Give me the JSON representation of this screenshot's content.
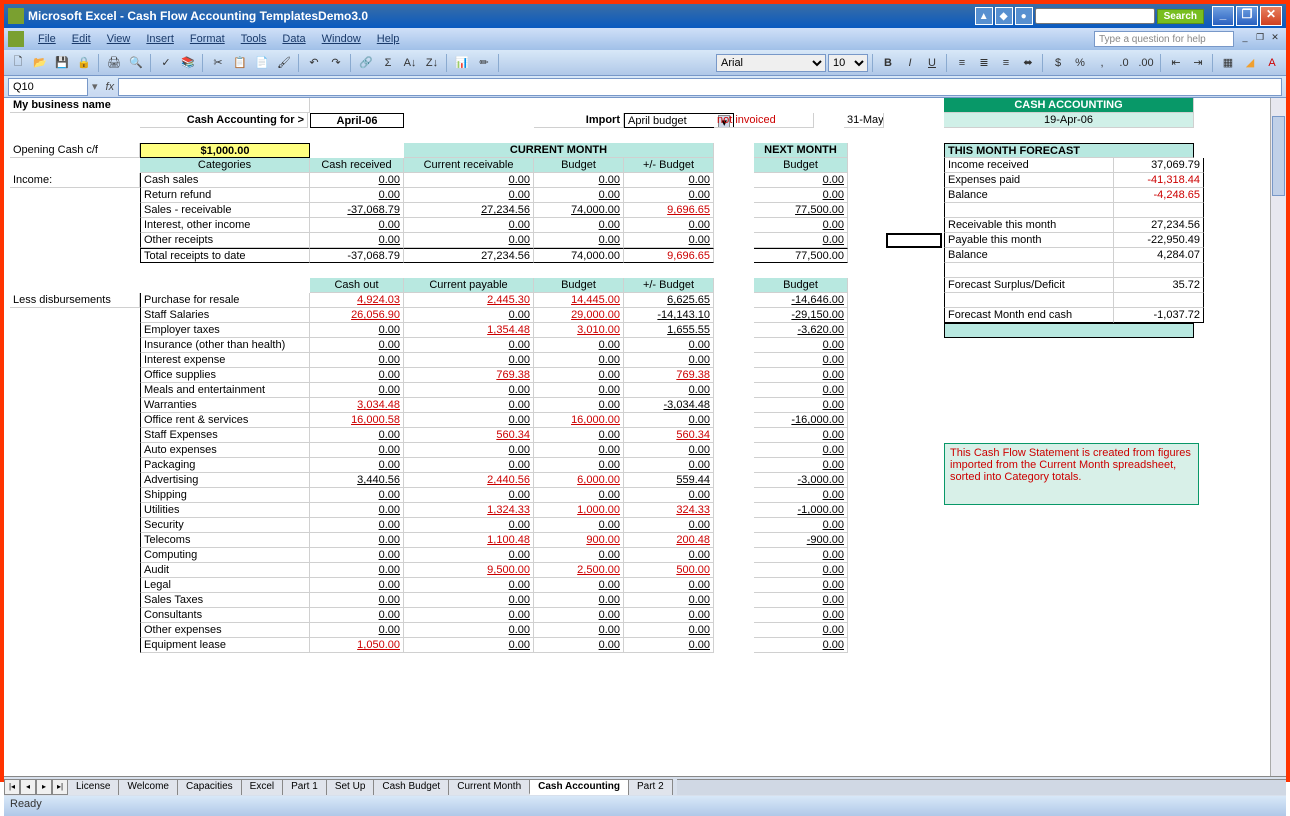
{
  "app": {
    "title": "Microsoft Excel - Cash Flow Accounting TemplatesDemo3.0",
    "search_btn": "Search",
    "help_placeholder": "Type a question for help"
  },
  "menu": [
    "File",
    "Edit",
    "View",
    "Insert",
    "Format",
    "Tools",
    "Data",
    "Window",
    "Help"
  ],
  "namebox": "Q10",
  "font_name": "Arial",
  "font_size": "10",
  "header": {
    "business": "My business name",
    "label": "Cash Accounting for >",
    "period": "April-06",
    "import_label": "Import",
    "import_value": "April budget",
    "import_note": "not invoiced",
    "next_date": "31-May-06",
    "badge": "CASH ACCOUNTING",
    "badge_date": "19-Apr-06"
  },
  "opening": {
    "label": "Opening Cash c/f",
    "value": "$1,000.00",
    "current_month": "CURRENT MONTH",
    "next_month": "NEXT MONTH",
    "forecast_title": "THIS MONTH FORECAST"
  },
  "cols_income": {
    "categories": "Categories",
    "cash_received": "Cash received",
    "current_receivable": "Current receivable",
    "budget": "Budget",
    "pm_budget": "+/- Budget",
    "next_budget": "Budget"
  },
  "income_label": "Income:",
  "income_rows": [
    {
      "cat": "Cash sales",
      "v": [
        "0.00",
        "0.00",
        "0.00",
        "0.00",
        "0.00"
      ]
    },
    {
      "cat": "Return refund",
      "v": [
        "0.00",
        "0.00",
        "0.00",
        "0.00",
        "0.00"
      ]
    },
    {
      "cat": "Sales - receivable",
      "v": [
        "-37,068.79",
        "27,234.56",
        "74,000.00",
        "9,696.65",
        "77,500.00"
      ],
      "neg": [
        3
      ]
    },
    {
      "cat": "Interest, other income",
      "v": [
        "0.00",
        "0.00",
        "0.00",
        "0.00",
        "0.00"
      ]
    },
    {
      "cat": "Other receipts",
      "v": [
        "0.00",
        "0.00",
        "0.00",
        "0.00",
        "0.00"
      ]
    }
  ],
  "income_total": {
    "cat": "Total receipts to date",
    "v": [
      "-37,068.79",
      "27,234.56",
      "74,000.00",
      "9,696.65",
      "77,500.00"
    ],
    "neg": [
      3
    ]
  },
  "cols_exp": {
    "cash_out": "Cash out",
    "current_payable": "Current payable",
    "budget": "Budget",
    "pm_budget": "+/- Budget",
    "next_budget": "Budget"
  },
  "less_label": "Less disbursements",
  "exp_rows": [
    {
      "cat": "Purchase for resale",
      "v": [
        "4,924.03",
        "2,445.30",
        "14,445.00",
        "6,625.65",
        "-14,646.00"
      ],
      "neg": [
        0,
        1,
        2
      ]
    },
    {
      "cat": "Staff Salaries",
      "v": [
        "26,056.90",
        "0.00",
        "29,000.00",
        "-14,143.10",
        "-29,150.00"
      ],
      "neg": [
        0,
        2
      ]
    },
    {
      "cat": "Employer taxes",
      "v": [
        "0.00",
        "1,354.48",
        "3,010.00",
        "1,655.55",
        "-3,620.00"
      ],
      "neg": [
        1,
        2
      ]
    },
    {
      "cat": "Insurance (other than health)",
      "v": [
        "0.00",
        "0.00",
        "0.00",
        "0.00",
        "0.00"
      ]
    },
    {
      "cat": "Interest expense",
      "v": [
        "0.00",
        "0.00",
        "0.00",
        "0.00",
        "0.00"
      ]
    },
    {
      "cat": "Office supplies",
      "v": [
        "0.00",
        "769.38",
        "0.00",
        "769.38",
        "0.00"
      ],
      "neg": [
        1,
        3
      ]
    },
    {
      "cat": "Meals and entertainment",
      "v": [
        "0.00",
        "0.00",
        "0.00",
        "0.00",
        "0.00"
      ]
    },
    {
      "cat": "Warranties",
      "v": [
        "3,034.48",
        "0.00",
        "0.00",
        "-3,034.48",
        "0.00"
      ],
      "neg": [
        0
      ]
    },
    {
      "cat": "Office rent & services",
      "v": [
        "16,000.58",
        "0.00",
        "16,000.00",
        "0.00",
        "-16,000.00"
      ],
      "neg": [
        0,
        2
      ]
    },
    {
      "cat": "Staff Expenses",
      "v": [
        "0.00",
        "560.34",
        "0.00",
        "560.34",
        "0.00"
      ],
      "neg": [
        1,
        3
      ]
    },
    {
      "cat": "Auto expenses",
      "v": [
        "0.00",
        "0.00",
        "0.00",
        "0.00",
        "0.00"
      ]
    },
    {
      "cat": "Packaging",
      "v": [
        "0.00",
        "0.00",
        "0.00",
        "0.00",
        "0.00"
      ]
    },
    {
      "cat": "Advertising",
      "v": [
        "3,440.56",
        "2,440.56",
        "6,000.00",
        "559.44",
        "-3,000.00"
      ],
      "neg": [
        1,
        2
      ]
    },
    {
      "cat": "Shipping",
      "v": [
        "0.00",
        "0.00",
        "0.00",
        "0.00",
        "0.00"
      ]
    },
    {
      "cat": "Utilities",
      "v": [
        "0.00",
        "1,324.33",
        "1,000.00",
        "324.33",
        "-1,000.00"
      ],
      "neg": [
        1,
        2,
        3
      ]
    },
    {
      "cat": "Security",
      "v": [
        "0.00",
        "0.00",
        "0.00",
        "0.00",
        "0.00"
      ]
    },
    {
      "cat": "Telecoms",
      "v": [
        "0.00",
        "1,100.48",
        "900.00",
        "200.48",
        "-900.00"
      ],
      "neg": [
        1,
        2,
        3
      ]
    },
    {
      "cat": "Computing",
      "v": [
        "0.00",
        "0.00",
        "0.00",
        "0.00",
        "0.00"
      ]
    },
    {
      "cat": "Audit",
      "v": [
        "0.00",
        "9,500.00",
        "2,500.00",
        "500.00",
        "0.00"
      ],
      "neg": [
        1,
        2,
        3
      ]
    },
    {
      "cat": "Legal",
      "v": [
        "0.00",
        "0.00",
        "0.00",
        "0.00",
        "0.00"
      ]
    },
    {
      "cat": "Sales Taxes",
      "v": [
        "0.00",
        "0.00",
        "0.00",
        "0.00",
        "0.00"
      ]
    },
    {
      "cat": "Consultants",
      "v": [
        "0.00",
        "0.00",
        "0.00",
        "0.00",
        "0.00"
      ]
    },
    {
      "cat": "Other expenses",
      "v": [
        "0.00",
        "0.00",
        "0.00",
        "0.00",
        "0.00"
      ]
    },
    {
      "cat": "Equipment lease",
      "v": [
        "1,050.00",
        "0.00",
        "0.00",
        "0.00",
        "0.00"
      ],
      "neg": [
        0
      ]
    }
  ],
  "forecast": [
    {
      "k": "Income received",
      "v": "37,069.79"
    },
    {
      "k": "Expenses paid",
      "v": "-41,318.44",
      "neg": true
    },
    {
      "k": "Balance",
      "v": "-4,248.65",
      "neg": true
    },
    {
      "k": "",
      "v": ""
    },
    {
      "k": "Receivable this month",
      "v": "27,234.56"
    },
    {
      "k": "Payable this month",
      "v": "-22,950.49"
    },
    {
      "k": "Balance",
      "v": "4,284.07"
    },
    {
      "k": "",
      "v": ""
    },
    {
      "k": "Forecast Surplus/Deficit",
      "v": "35.72"
    },
    {
      "k": "",
      "v": ""
    },
    {
      "k": "Forecast Month end cash",
      "v": "-1,037.72"
    }
  ],
  "note": "This Cash Flow Statement is created from figures imported from the Current Month spreadsheet, sorted into Category totals.",
  "tabs": [
    "License",
    "Welcome",
    "Capacities",
    "Excel",
    "Part 1",
    "Set Up",
    "Cash Budget",
    "Current Month",
    "Cash Accounting",
    "Part 2"
  ],
  "active_tab": 8,
  "status": "Ready"
}
